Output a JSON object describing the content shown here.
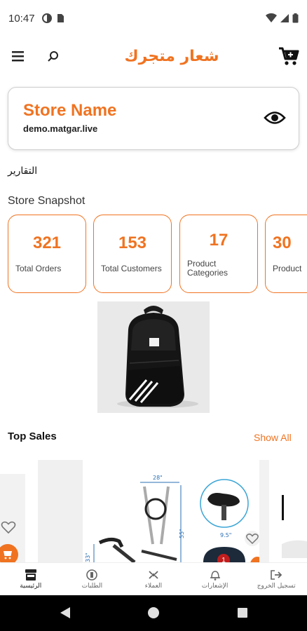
{
  "status_bar": {
    "time": "10:47"
  },
  "app_bar": {
    "logo_text": "شعار متجرك"
  },
  "store_card": {
    "name": "Store Name",
    "domain": "demo.matgar.live"
  },
  "reports_label": "التقارير",
  "snapshot": {
    "title": "Store Snapshot",
    "stats": [
      {
        "value": "321",
        "label": "Total Orders"
      },
      {
        "value": "153",
        "label": "Total Customers"
      },
      {
        "value": "17",
        "label": "Product Categories"
      },
      {
        "value": "30",
        "label": "Product"
      }
    ]
  },
  "top_sales": {
    "title": "Top Sales",
    "show_all": "Show All",
    "dimension_labels": [
      "28\"",
      "55\"",
      "33\""
    ],
    "badge_count": "1"
  },
  "bottom_nav": {
    "items": [
      {
        "label": "الرئيسية",
        "icon": "store-icon",
        "active": true
      },
      {
        "label": "الطلبات",
        "icon": "orders-icon",
        "active": false
      },
      {
        "label": "العملاء",
        "icon": "customers-icon",
        "active": false
      },
      {
        "label": "الإشعارات",
        "icon": "bell-icon",
        "active": false
      },
      {
        "label": "تسجيل الخروج",
        "icon": "logout-icon",
        "active": false
      }
    ]
  },
  "colors": {
    "accent": "#f07321",
    "badge": "#c21d1d"
  }
}
